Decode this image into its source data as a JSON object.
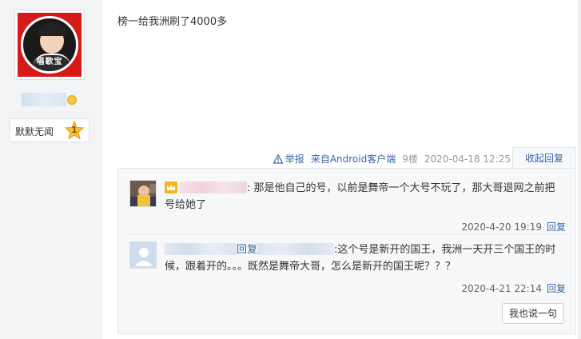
{
  "poster": {
    "avatar_caption": "唱歌宝",
    "badge_label": "默默无闻",
    "badge_level": "1"
  },
  "post": {
    "content": "榜一给我洲刷了4000多",
    "report_label": "举报",
    "source": "来自Android客户端",
    "floor": "9楼",
    "time": "2020-04-18 12:25",
    "collapse_label": "收起回复"
  },
  "replies": [
    {
      "text_suffix": ": 那是他自己的号，以前是舞帝一个大号不玩了，那大哥退网之前把号给她了",
      "time": "2020-4-20 19:19",
      "reply_label": "回复"
    },
    {
      "reply_word": "回复",
      "text_suffix": ":这个号是新开的国王，我洲一天开三个国王的时候，跟着开的。。。既然是舞帝大哥，怎么是新开的国王呢？？？",
      "time": "2020-4-21 22:14",
      "reply_label": "回复"
    }
  ],
  "say_button_label": "我也说一句",
  "colors": {
    "link": "#3b66a6",
    "avatar_bg": "#d61a1a",
    "sidebar_bg": "#f3f4f6",
    "reply_box_bg": "#f7f8fa"
  }
}
